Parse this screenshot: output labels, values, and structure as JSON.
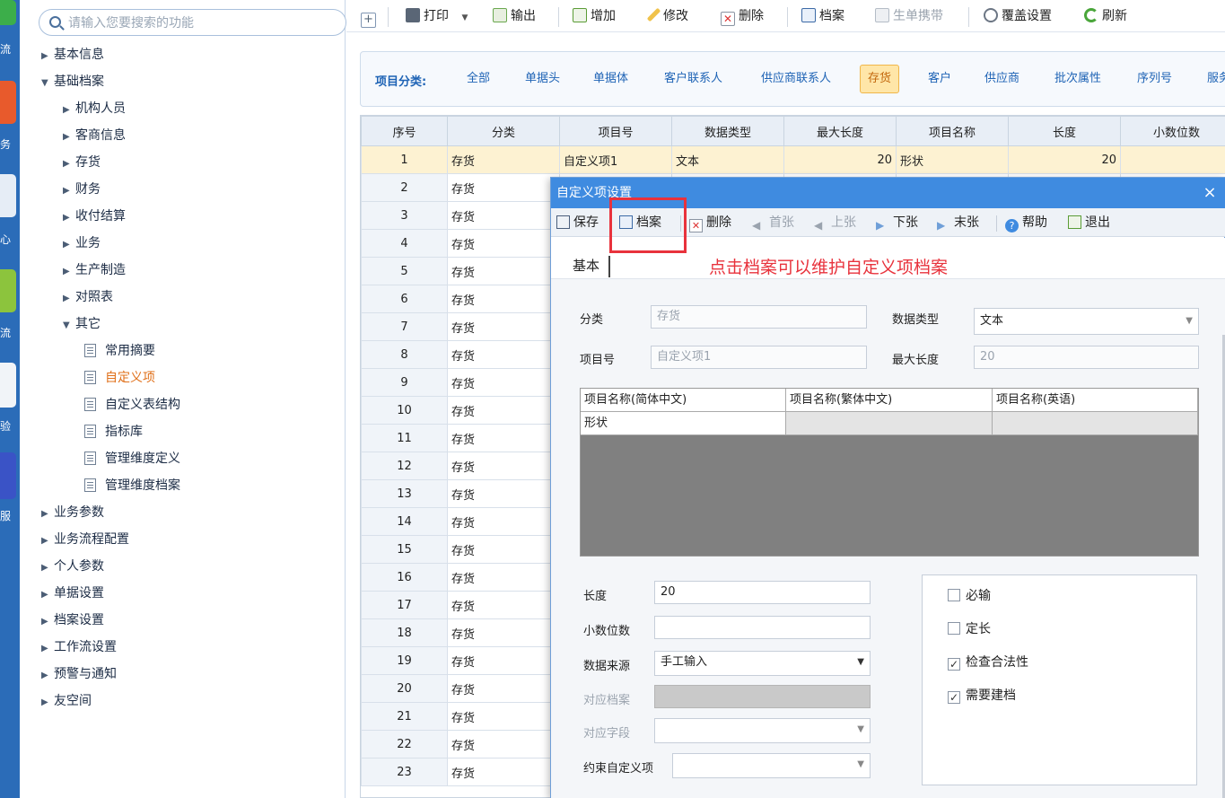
{
  "colors": {
    "accent": "#3f8be0",
    "active_tab_bg": "#ffe6a8",
    "annotation": "#e8323c",
    "tree_active": "#e0701a"
  },
  "app_strip": {
    "labels": [
      "流",
      "务",
      "心",
      "流",
      "验",
      "服"
    ]
  },
  "search": {
    "placeholder": "请输入您要搜索的功能"
  },
  "sidebar": {
    "items": [
      {
        "label": "基本信息",
        "expanded": false
      },
      {
        "label": "基础档案",
        "expanded": true
      },
      {
        "label": "机构人员",
        "expanded": false
      },
      {
        "label": "客商信息",
        "expanded": false
      },
      {
        "label": "存货",
        "expanded": false
      },
      {
        "label": "财务",
        "expanded": false
      },
      {
        "label": "收付结算",
        "expanded": false
      },
      {
        "label": "业务",
        "expanded": false
      },
      {
        "label": "生产制造",
        "expanded": false
      },
      {
        "label": "对照表",
        "expanded": false
      },
      {
        "label": "其它",
        "expanded": true
      },
      {
        "label": "常用摘要"
      },
      {
        "label": "自定义项",
        "active": true
      },
      {
        "label": "自定义表结构"
      },
      {
        "label": "指标库"
      },
      {
        "label": "管理维度定义"
      },
      {
        "label": "管理维度档案"
      },
      {
        "label": "业务参数",
        "expanded": false
      },
      {
        "label": "业务流程配置",
        "expanded": false
      },
      {
        "label": "个人参数",
        "expanded": false
      },
      {
        "label": "单据设置",
        "expanded": false
      },
      {
        "label": "档案设置",
        "expanded": false
      },
      {
        "label": "工作流设置",
        "expanded": false
      },
      {
        "label": "预警与通知",
        "expanded": false
      },
      {
        "label": "友空间",
        "expanded": false
      }
    ]
  },
  "toolbar": {
    "print": "打印",
    "export": "输出",
    "add": "增加",
    "edit": "修改",
    "delete": "删除",
    "archive": "档案",
    "gen_ribbon": "生单携带",
    "override": "覆盖设置",
    "refresh": "刷新"
  },
  "categories": {
    "title": "项目分类:",
    "items": [
      "全部",
      "单据头",
      "单据体",
      "客户联系人",
      "供应商联系人",
      "存货",
      "客户",
      "供应商",
      "批次属性",
      "序列号",
      "服务"
    ],
    "active": "存货"
  },
  "grid": {
    "columns": [
      "序号",
      "分类",
      "项目号",
      "数据类型",
      "最大长度",
      "项目名称",
      "长度",
      "小数位数"
    ],
    "first_row": {
      "idx": "1",
      "category": "存货",
      "item_no": "自定义项1",
      "data_type": "文本",
      "max_len": "20",
      "name": "形状",
      "len": "20",
      "decimals": ""
    },
    "row_indices": [
      "2",
      "3",
      "4",
      "5",
      "6",
      "7",
      "8",
      "9",
      "10",
      "11",
      "12",
      "13",
      "14",
      "15",
      "16",
      "17",
      "18",
      "19",
      "20",
      "21",
      "22",
      "23"
    ],
    "row_category": "存货"
  },
  "dialog": {
    "title": "自定义项设置",
    "close": "×",
    "toolbar": {
      "save": "保存",
      "archive": "档案",
      "delete": "删除",
      "first": "首张",
      "prev": "上张",
      "next": "下张",
      "last": "末张",
      "help": "帮助",
      "exit": "退出"
    },
    "tab": "基本",
    "annotation": "点击档案可以维护自定义项档案",
    "fields": {
      "category_label": "分类",
      "category_value": "存货",
      "data_type_label": "数据类型",
      "data_type_value": "文本",
      "item_no_label": "项目号",
      "item_no_value": "自定义项1",
      "max_len_label": "最大长度",
      "max_len_value": "20",
      "length_label": "长度",
      "length_value": "20",
      "decimals_label": "小数位数",
      "decimals_value": "",
      "source_label": "数据来源",
      "source_value": "手工输入",
      "archive_label": "对应档案",
      "field_label": "对应字段",
      "constraint_label": "约束自定义项"
    },
    "name_grid": {
      "headers": [
        "项目名称(简体中文)",
        "项目名称(繁体中文)",
        "项目名称(英语)"
      ],
      "values": [
        "形状",
        "",
        ""
      ]
    },
    "checks": [
      {
        "label": "必输",
        "checked": false
      },
      {
        "label": "定长",
        "checked": false
      },
      {
        "label": "检查合法性",
        "checked": true
      },
      {
        "label": "需要建档",
        "checked": true
      }
    ]
  }
}
